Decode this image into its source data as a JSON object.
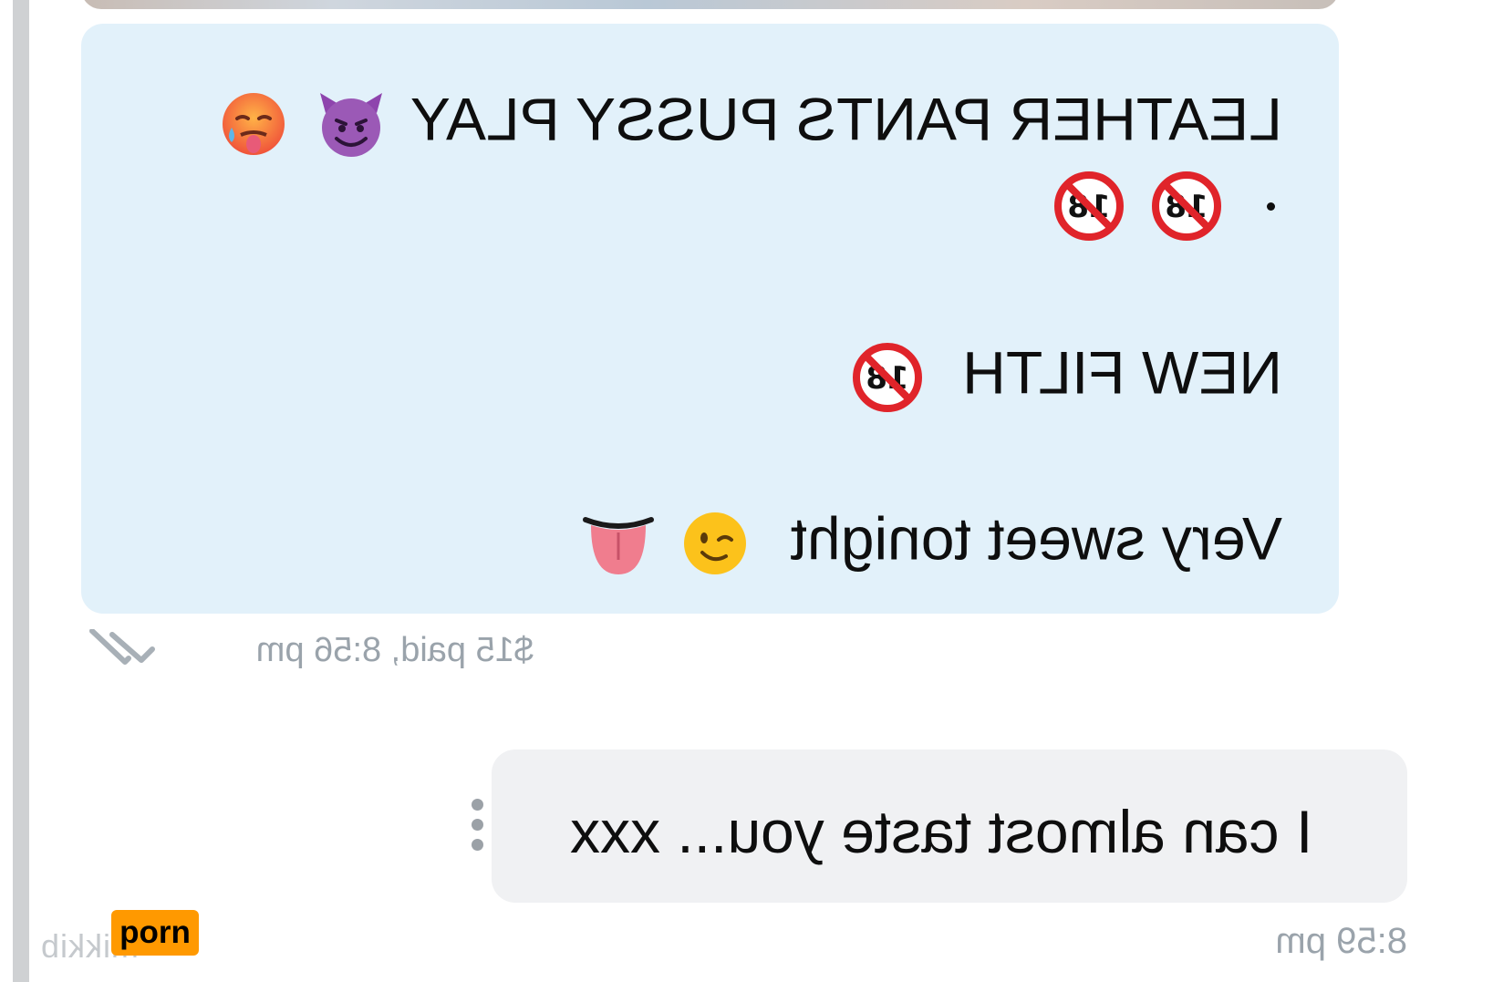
{
  "chat": {
    "incoming": {
      "line1": "LEATHER PANTS PUSSY PLAY",
      "line2_dot": ".",
      "line3": "NEW FILTH",
      "line4": "Very sweet tonight",
      "meta": "$15 paid, 8:56 pm",
      "emoji_line1": [
        "devil-face-icon",
        "hot-face-icon"
      ],
      "emoji_line2": [
        "no-one-under-eighteen-icon",
        "no-one-under-eighteen-icon"
      ],
      "emoji_line3": [
        "no-one-under-eighteen-icon"
      ],
      "emoji_line4": [
        "winking-face-icon",
        "tongue-icon"
      ]
    },
    "outgoing": {
      "text": "I can almost taste you... xxx",
      "time": "8:59 pm"
    }
  },
  "watermark": {
    "text": "mikkib",
    "badge": "porn"
  },
  "colors": {
    "incoming_bubble": "#e2f1fa",
    "outgoing_bubble": "#f0f1f3",
    "meta_text": "#9aa3ab",
    "badge": "#ff9900"
  }
}
